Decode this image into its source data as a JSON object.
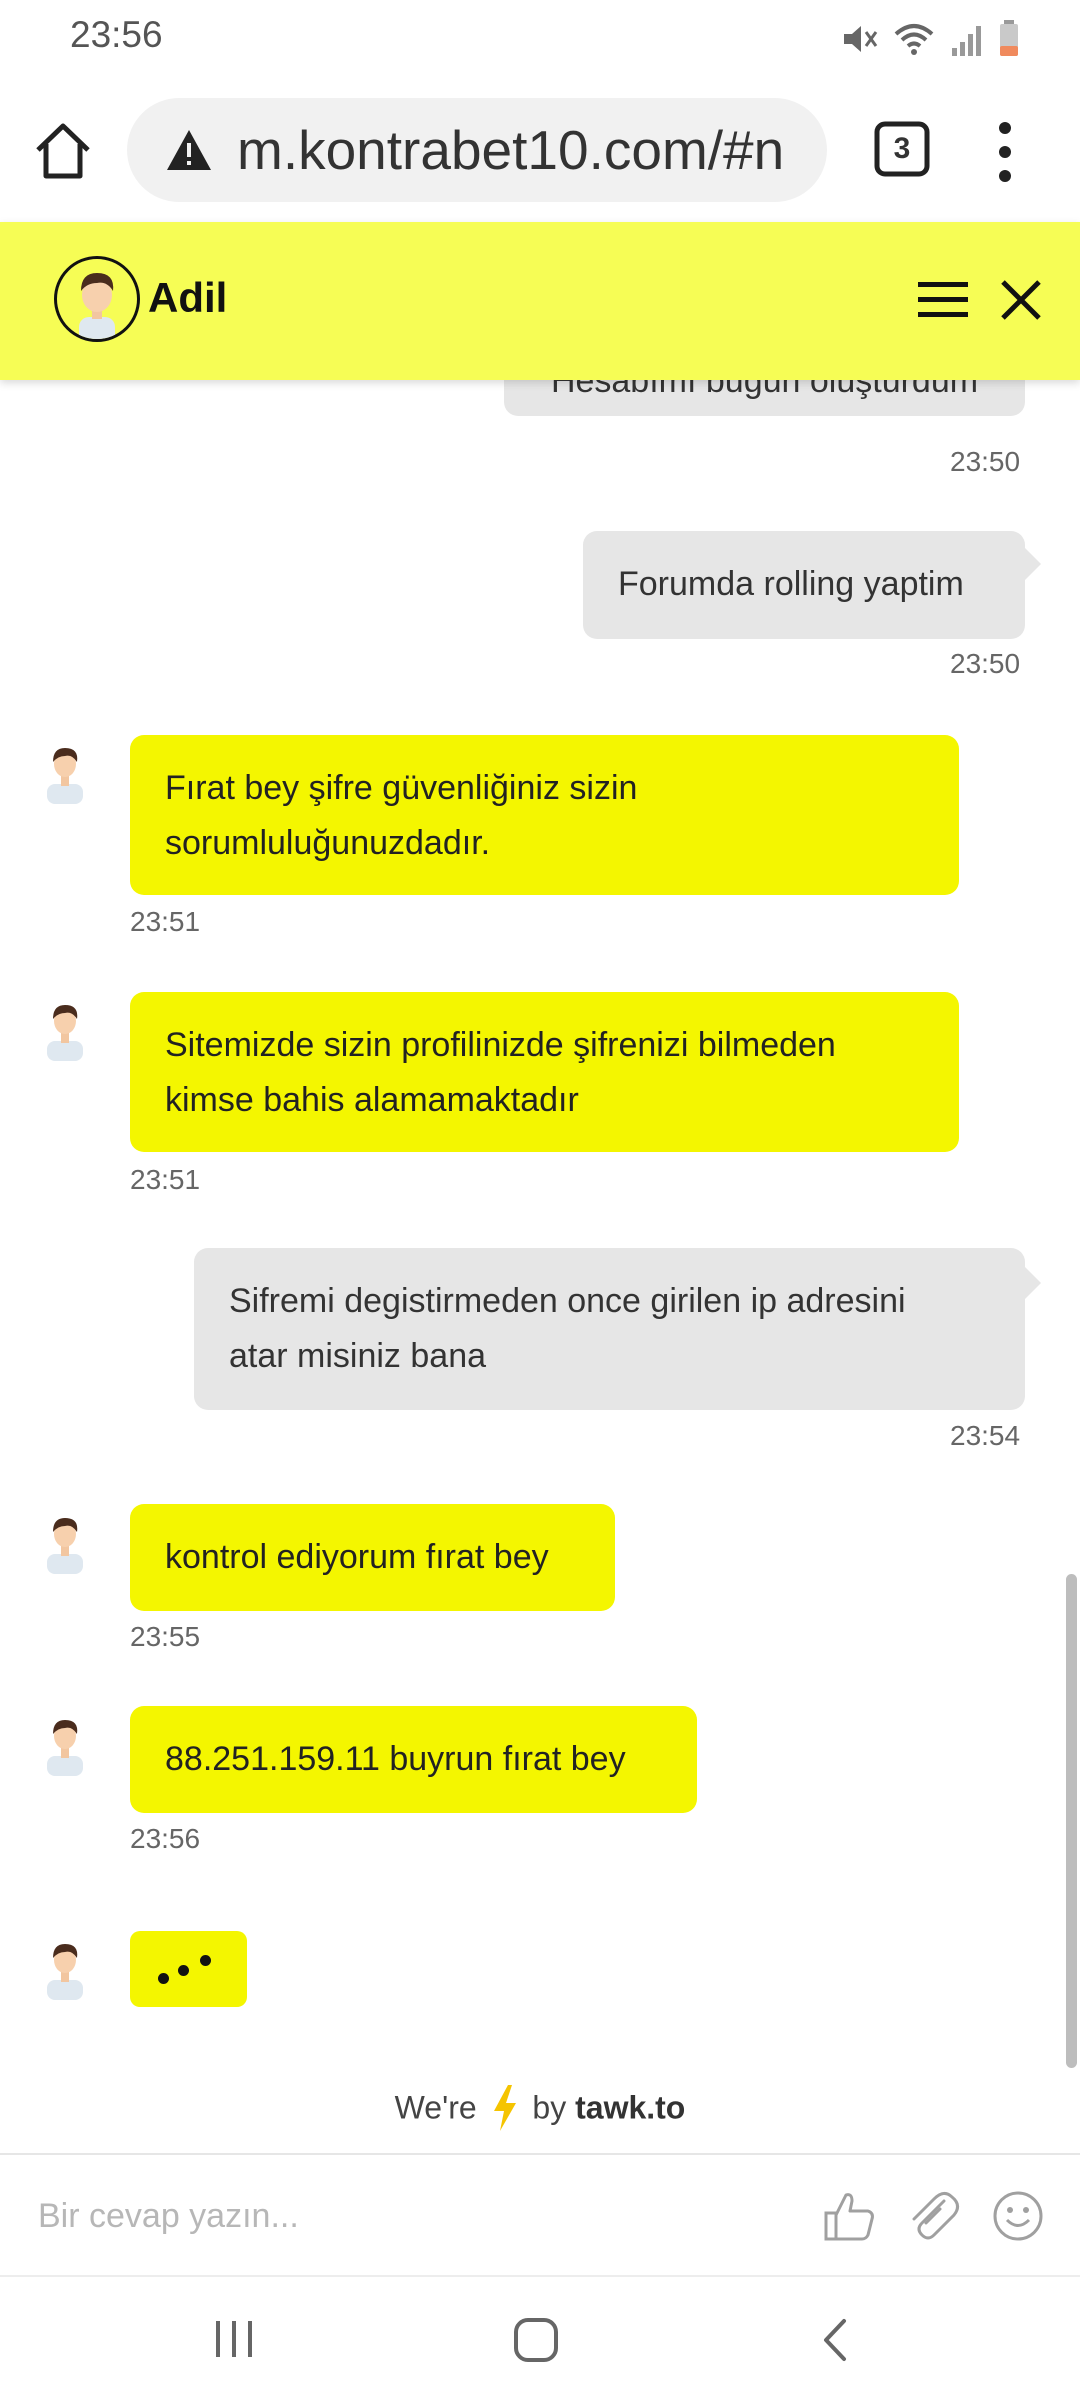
{
  "status_bar": {
    "time": "23:56"
  },
  "browser": {
    "url": "m.kontrabet10.com/#n",
    "tab_count": "3"
  },
  "chat": {
    "agent_name": "Adil",
    "messages": [
      {
        "from": "visitor",
        "text": "Hesabımı bugün oluşturdum",
        "time": "23:50"
      },
      {
        "from": "visitor",
        "text": "Forumda rolling yaptim",
        "time": "23:50"
      },
      {
        "from": "agent",
        "line1": "Fırat bey şifre güvenliğiniz sizin",
        "line2": "sorumluluğunuzdadır.",
        "time": "23:51"
      },
      {
        "from": "agent",
        "line1": "Sitemizde sizin profilinizde şifrenizi bilmeden",
        "line2": "kimse bahis alamamaktadır",
        "time": "23:51"
      },
      {
        "from": "visitor",
        "line1": "Sifremi degistirmeden once girilen ip adresini",
        "line2": "atar misiniz bana",
        "time": "23:54"
      },
      {
        "from": "agent",
        "text": "kontrol ediyorum fırat bey",
        "time": "23:55"
      },
      {
        "from": "agent",
        "text": "88.251.159.11 buyrun fırat bey",
        "time": "23:56"
      }
    ],
    "powered_prefix": "We're",
    "powered_by": "by",
    "powered_brand": "tawk.to"
  },
  "composer": {
    "placeholder": "Bir cevap yazın..."
  },
  "colors": {
    "accent": "#f4f600",
    "header": "#f6fd55",
    "visitor_bubble": "#e6e6e6"
  },
  "icons": [
    "home-icon",
    "warning-icon",
    "tabs-icon",
    "more-vert-icon",
    "menu-icon",
    "close-icon",
    "thumbs-up-icon",
    "paperclip-icon",
    "emoji-icon",
    "recents-icon",
    "nav-home-icon",
    "back-icon"
  ]
}
